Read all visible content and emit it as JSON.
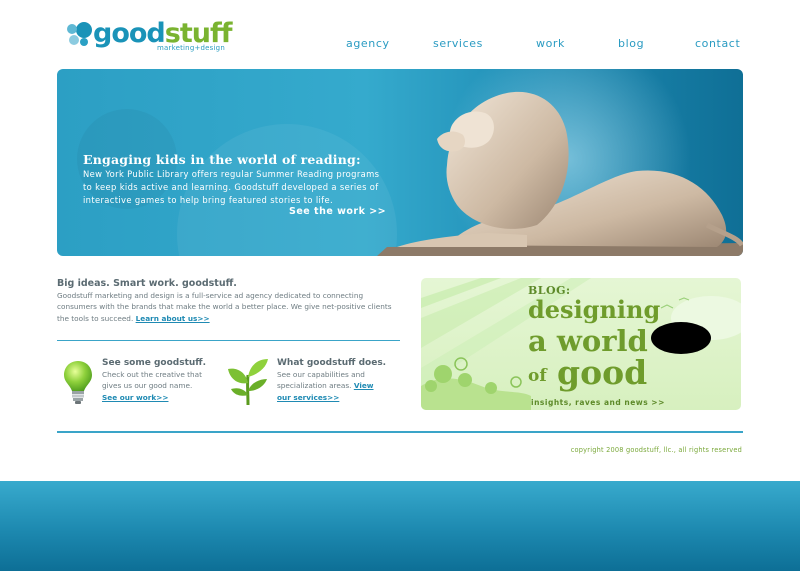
{
  "header": {
    "logo_good": "good",
    "logo_stuff": "stuff",
    "logo_tagline": "marketing+design",
    "nav": [
      {
        "label": "agency"
      },
      {
        "label": "services"
      },
      {
        "label": "work"
      },
      {
        "label": "blog"
      },
      {
        "label": "contact"
      }
    ]
  },
  "hero": {
    "title": "Engaging kids in the world of reading:",
    "body": "New York Public Library offers regular Summer Reading programs to keep kids active and learning. Goodstuff developed a series of interactive games to help bring featured stories to life.",
    "cta": "See the work >>"
  },
  "intro": {
    "title": "Big ideas. Smart work. goodstuff.",
    "body": "Goodstuff marketing and design is a full-service ad agency dedicated to connecting consumers with the brands that make the world a better place. We give net-positive clients the tools to succeed.",
    "link": "Learn about us>>"
  },
  "features": [
    {
      "title": "See some goodstuff.",
      "body": "Check out the creative that gives us our good name.",
      "link": "See our work>>",
      "icon": "lightbulb-icon"
    },
    {
      "title": "What goodstuff does.",
      "body": "See our capabilities and specialization areas.",
      "link": "View our services>>",
      "icon": "plant-icon"
    }
  ],
  "blog": {
    "label": "BLOG:",
    "line1": "designing",
    "line2": "a world",
    "line3_of": "of",
    "line3_good": "good",
    "tagline": "insights, raves and news  >>"
  },
  "footer": {
    "copyright": "copyright 2008 goodstuff, llc., all rights reserved"
  },
  "colors": {
    "brand_blue": "#1a93b8",
    "brand_green": "#7ab330",
    "link_blue": "#1f8ab3"
  }
}
